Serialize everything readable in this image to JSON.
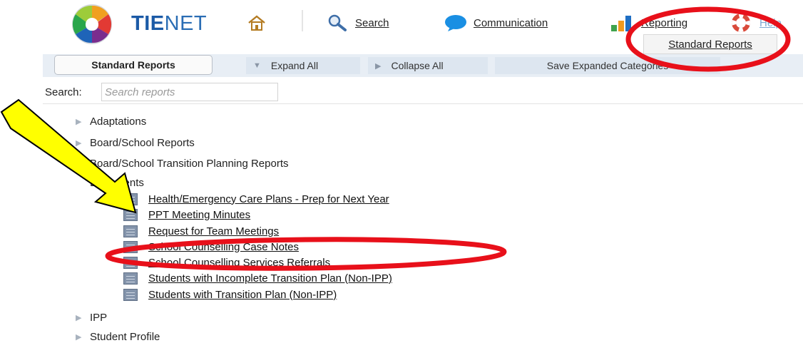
{
  "brand": {
    "name_part1": "TIE",
    "name_part2": "NET"
  },
  "nav": {
    "search": "Search",
    "communication": "Communication",
    "reporting": "Reporting",
    "help": "Help",
    "dropdown_item": "Standard Reports"
  },
  "toolbar": {
    "standard_reports": "Standard Reports",
    "expand_all": "Expand All",
    "collapse_all": "Collapse All",
    "save_expanded": "Save Expanded Categories"
  },
  "search": {
    "label": "Search:",
    "placeholder": "Search reports"
  },
  "tree": {
    "categories": [
      "Adaptations",
      "Board/School Reports",
      "Board/School Transition Planning Reports",
      "Documents",
      "IPP",
      "Student Profile"
    ],
    "documents_reports": [
      "Health/Emergency Care Plans - Prep for Next Year",
      "PPT Meeting Minutes",
      "Request for Team Meetings",
      "School Counselling Case Notes",
      "School Counselling Services Referrals",
      "Students with Incomplete Transition Plan (Non-IPP)",
      "Students with Transition Plan (Non-IPP)"
    ]
  },
  "colors": {
    "annotation_red": "#e8101a",
    "arrow_yellow": "#ffff00",
    "brand_blue": "#1b5aa6",
    "toolbar_bg": "#e8eef5"
  }
}
